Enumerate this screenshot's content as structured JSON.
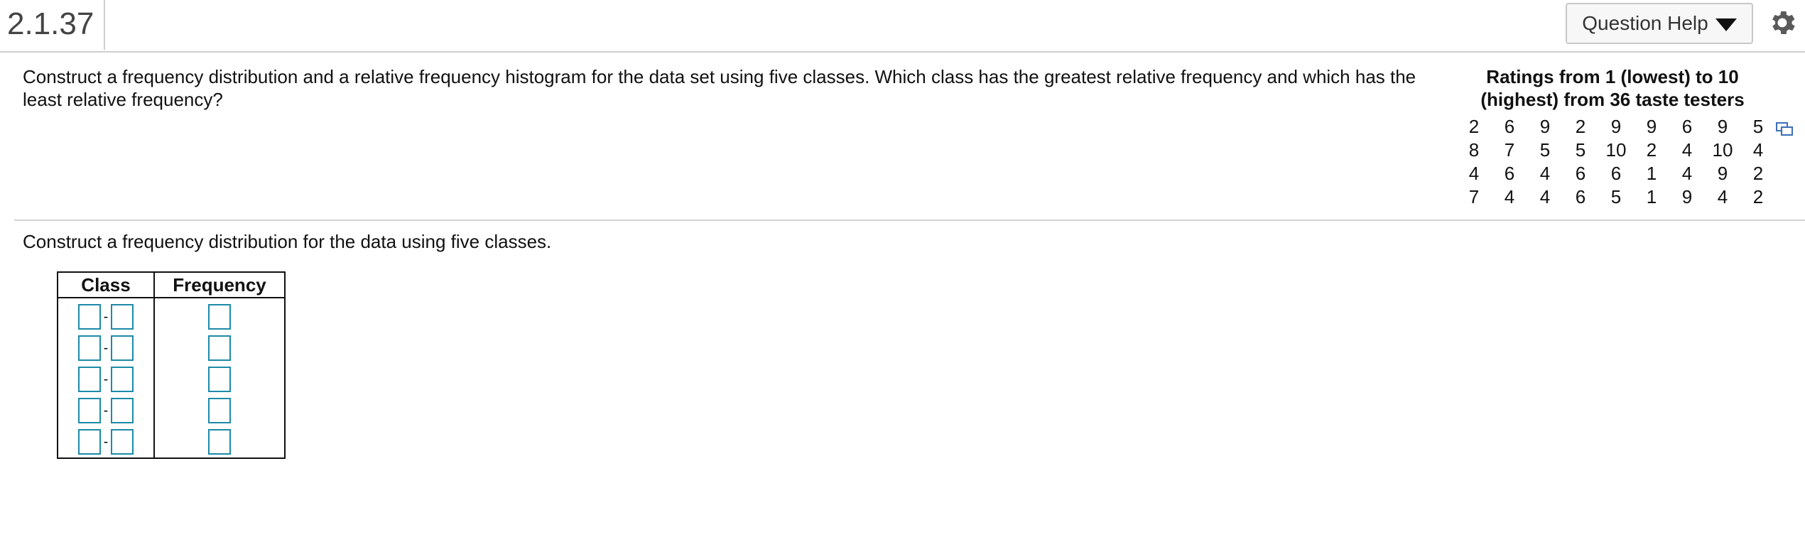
{
  "header": {
    "question_number": "2.1.37",
    "help_label": "Question Help"
  },
  "prompt": "Construct a frequency distribution and a relative frequency histogram for the data set using five classes. Which class has the greatest relative frequency and which has the least relative frequency?",
  "data_title": "Ratings from 1 (lowest) to 10 (highest) from 36 taste testers",
  "ratings": [
    [
      "2",
      "6",
      "9",
      "2",
      "9",
      "9",
      "6",
      "9",
      "5"
    ],
    [
      "8",
      "7",
      "5",
      "5",
      "10",
      "2",
      "4",
      "10",
      "4"
    ],
    [
      "4",
      "6",
      "4",
      "6",
      "6",
      "1",
      "4",
      "9",
      "2"
    ],
    [
      "7",
      "4",
      "4",
      "6",
      "5",
      "1",
      "9",
      "4",
      "2"
    ]
  ],
  "instruction": "Construct a frequency distribution for the data using five classes.",
  "table": {
    "headers": [
      "Class",
      "Frequency"
    ],
    "rows": [
      {
        "class_lower": "",
        "class_upper": "",
        "frequency": ""
      },
      {
        "class_lower": "",
        "class_upper": "",
        "frequency": ""
      },
      {
        "class_lower": "",
        "class_upper": "",
        "frequency": ""
      },
      {
        "class_lower": "",
        "class_upper": "",
        "frequency": ""
      },
      {
        "class_lower": "",
        "class_upper": "",
        "frequency": ""
      }
    ]
  },
  "colors": {
    "input_border": "#1d8aa8"
  },
  "icons": [
    "caret-down-icon",
    "gear-icon",
    "copy-data-icon"
  ]
}
